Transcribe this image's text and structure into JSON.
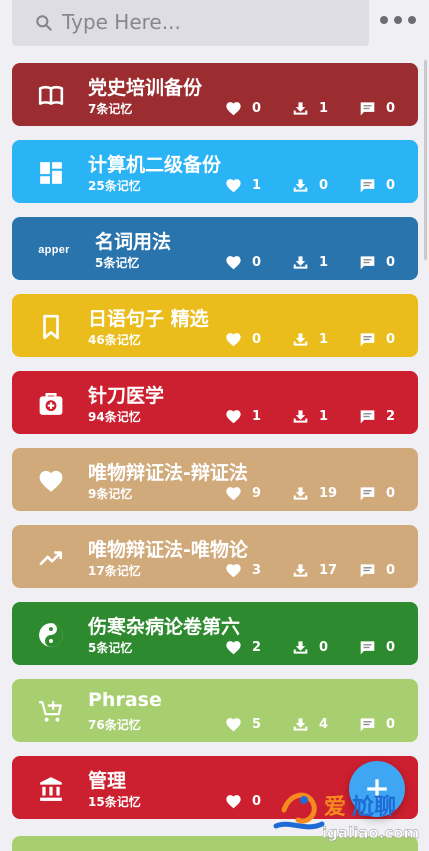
{
  "search": {
    "placeholder": "Type Here..."
  },
  "cards": [
    {
      "title": "党史培训备份",
      "count": "7条记忆",
      "likes": "0",
      "downloads": "1",
      "comments": "0",
      "color": "#9b2d30",
      "icon": "book-icon"
    },
    {
      "title": "计算机二级备份",
      "count": "25条记忆",
      "likes": "1",
      "downloads": "0",
      "comments": "0",
      "color": "#2ab3f5",
      "icon": "dashboard-icon"
    },
    {
      "title": "名词用法",
      "count": "5条记忆",
      "likes": "0",
      "downloads": "1",
      "comments": "0",
      "color": "#2a74ad",
      "icon": "apper-text-icon",
      "icon_text": "apper"
    },
    {
      "title": "日语句子 精选",
      "count": "46条记忆",
      "likes": "0",
      "downloads": "1",
      "comments": "0",
      "color": "#eabd1c",
      "icon": "bookmark-icon"
    },
    {
      "title": "针刀医学",
      "count": "94条记忆",
      "likes": "1",
      "downloads": "1",
      "comments": "2",
      "color": "#cc1f2f",
      "icon": "medical-bag-icon"
    },
    {
      "title": "唯物辩证法-辩证法",
      "count": "9条记忆",
      "likes": "9",
      "downloads": "19",
      "comments": "0",
      "color": "#d1aa7c",
      "icon": "heart-icon"
    },
    {
      "title": "唯物辩证法-唯物论",
      "count": "17条记忆",
      "likes": "3",
      "downloads": "17",
      "comments": "0",
      "color": "#d1aa7c",
      "icon": "trending-up-icon"
    },
    {
      "title": "伤寒杂病论卷第六",
      "count": "5条记忆",
      "likes": "2",
      "downloads": "0",
      "comments": "0",
      "color": "#2e8a2e",
      "icon": "yin-yang-icon"
    },
    {
      "title": "Phrase",
      "count": "76条记忆",
      "likes": "5",
      "downloads": "4",
      "comments": "0",
      "color": "#a8cf6f",
      "icon": "cart-add-icon"
    },
    {
      "title": "管理",
      "count": "15条记忆",
      "likes": "0",
      "downloads": "",
      "comments": "",
      "color": "#cc1f2f",
      "icon": "bank-icon"
    }
  ],
  "partial_card_color": "#a8cf6f",
  "fab_color": "#3ea6f2",
  "watermark": {
    "text1": "爱",
    "text2": "尬聊",
    "url": "igaliao.com"
  }
}
